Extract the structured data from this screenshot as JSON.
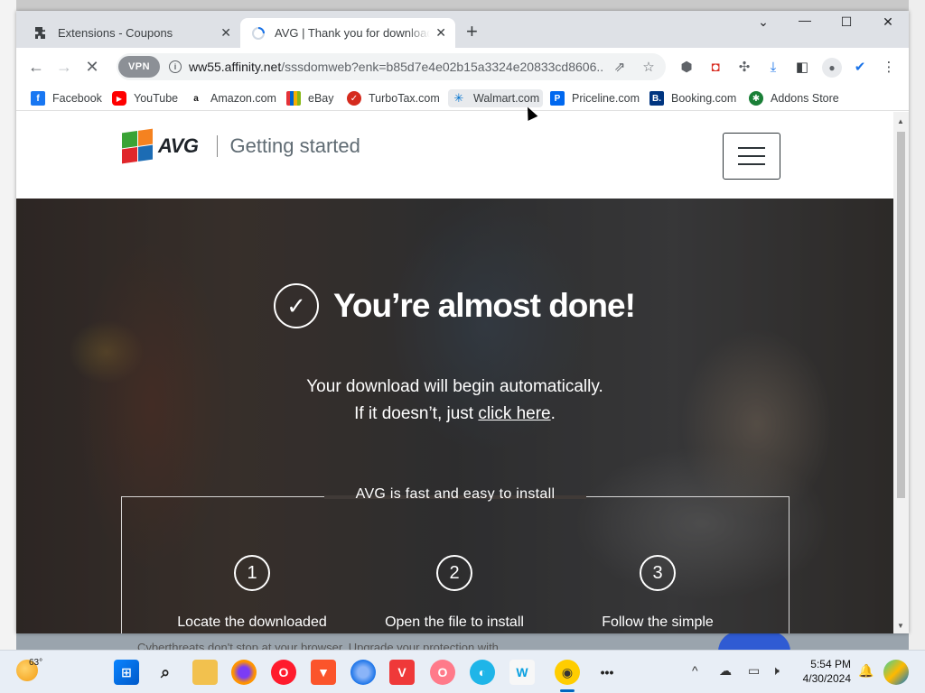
{
  "browser": {
    "tabs": [
      {
        "title": "Extensions - Coupons",
        "icon": "puzzle-icon",
        "active": false
      },
      {
        "title": "AVG | Thank you for downloading",
        "icon": "loading-icon",
        "active": true
      }
    ],
    "new_tab": "+",
    "url_host": "ww55.affinity.net",
    "url_path": "/sssdomweb?enk=b85d7e4e02b15a3324e20833cd8606...",
    "vpn_label": "VPN"
  },
  "bookmarks": [
    {
      "label": "Facebook",
      "icon": "facebook-icon",
      "color": "#1877f2"
    },
    {
      "label": "YouTube",
      "icon": "youtube-icon",
      "color": "#ff0000"
    },
    {
      "label": "Amazon.com",
      "icon": "amazon-icon",
      "color": "#ffffff"
    },
    {
      "label": "eBay",
      "icon": "ebay-icon",
      "color": "#ffffff"
    },
    {
      "label": "TurboTax.com",
      "icon": "turbotax-icon",
      "color": "#d52b1e"
    },
    {
      "label": "Walmart.com",
      "icon": "walmart-icon",
      "color": "#ffffff"
    },
    {
      "label": "Priceline.com",
      "icon": "priceline-icon",
      "color": "#0068ef"
    },
    {
      "label": "Booking.com",
      "icon": "booking-icon",
      "color": "#003580"
    },
    {
      "label": "Addons Store",
      "icon": "addons-icon",
      "color": "#1a7f37"
    }
  ],
  "avg": {
    "brand": "AVG",
    "subtitle": "Getting started",
    "headline": "You’re almost done!",
    "msg_line1": "Your download will begin automatically.",
    "msg_line2_prefix": "If it doesn’t, just ",
    "msg_link": "click here",
    "msg_line2_suffix": ".",
    "install_title": "AVG is fast and easy to install",
    "steps": [
      {
        "num": "1",
        "label": "Locate the downloaded"
      },
      {
        "num": "2",
        "label": "Open the file to install"
      },
      {
        "num": "3",
        "label": "Follow the simple"
      }
    ]
  },
  "behind": {
    "text": "Cyberthreats don't stop at your browser. Upgrade your protection with"
  },
  "taskbar": {
    "temperature": "63°",
    "time": "5:54 PM",
    "date": "4/30/2024",
    "more": "•••"
  }
}
